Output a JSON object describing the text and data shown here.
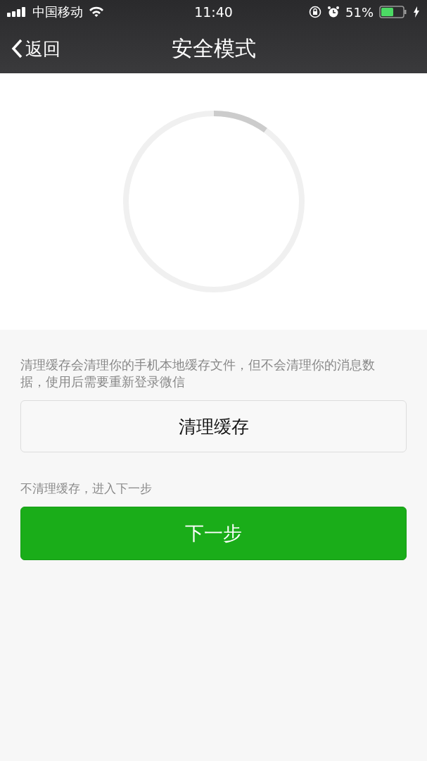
{
  "status_bar": {
    "carrier": "中国移动",
    "time": "11:40",
    "battery": "51%"
  },
  "nav_bar": {
    "back": "返回",
    "title": "安全模式"
  },
  "progress": {
    "level": 0.1
  },
  "description": "清理缓存会清理你的手机本地缓存文件，但不会清理你的消息数据，使用后需要重新登录微信",
  "clear_button": "清理缓存",
  "skip_label": "不清理缓存，进入下一步",
  "next_button": "下一步"
}
